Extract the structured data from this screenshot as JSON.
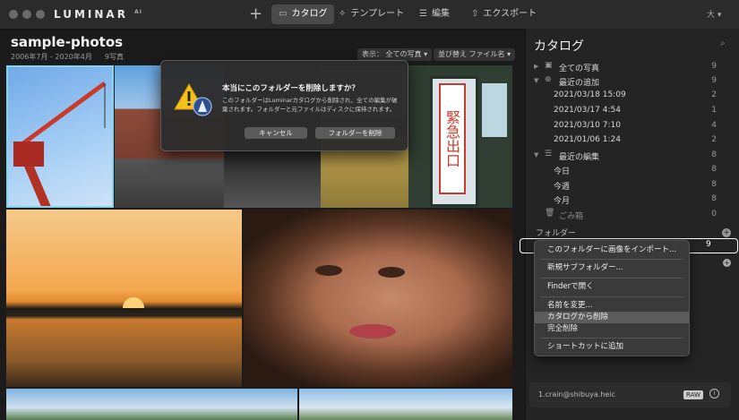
{
  "app": {
    "logo": "LUMINAR",
    "logo_suffix": "AI",
    "size_indicator": "大"
  },
  "tabs": [
    {
      "label": "カタログ",
      "icon": "folder-icon"
    },
    {
      "label": "テンプレート",
      "icon": "magic-wand-icon"
    },
    {
      "label": "編集",
      "icon": "sliders-icon"
    },
    {
      "label": "エクスポート",
      "icon": "share-icon"
    }
  ],
  "library": {
    "title": "sample-photos",
    "date_range": "2006年7月 - 2020年4月",
    "photo_count": "9写真",
    "view_label": "表示： 全ての写真",
    "sort_label": "並び替え ファイル名"
  },
  "sidebar": {
    "title": "カタログ",
    "rows": [
      {
        "label": "全ての写真",
        "count": "9"
      },
      {
        "label": "最近の追加",
        "count": "9"
      },
      {
        "label": "2021/03/18 15:09",
        "count": "2"
      },
      {
        "label": "2021/03/17 4:54",
        "count": "1"
      },
      {
        "label": "2021/03/10 7:10",
        "count": "4"
      },
      {
        "label": "2021/01/06 1:24",
        "count": "2"
      },
      {
        "label": "最近の編集",
        "count": "8"
      },
      {
        "label": "今日",
        "count": "8"
      },
      {
        "label": "今週",
        "count": "8"
      },
      {
        "label": "今月",
        "count": "8"
      },
      {
        "label": "ごみ箱",
        "count": "0"
      }
    ],
    "folders_label": "フォルダー",
    "selected_folder_count": "9"
  },
  "context_menu": {
    "items": [
      "このフォルダーに画像をインポート...",
      "新規サブフォルダー...",
      "Finderで開く",
      "名前を変更...",
      "カタログから削除",
      "完全削除",
      "ショートカットに追加"
    ]
  },
  "file_info": {
    "filename": "1.crain@shibuya.heic",
    "badge": "RAW",
    "info": "i"
  },
  "dialog": {
    "title": "本当にこのフォルダーを削除しますか？",
    "message": "このフォルダーはLuminarカタログから削除され、全ての編集が破棄されます。フォルダーと元ファイルはディスクに保持されます。",
    "cancel_label": "キャンセル",
    "delete_label": "フォルダーを削除"
  },
  "photos": {
    "sign_text": "緊急出口"
  }
}
